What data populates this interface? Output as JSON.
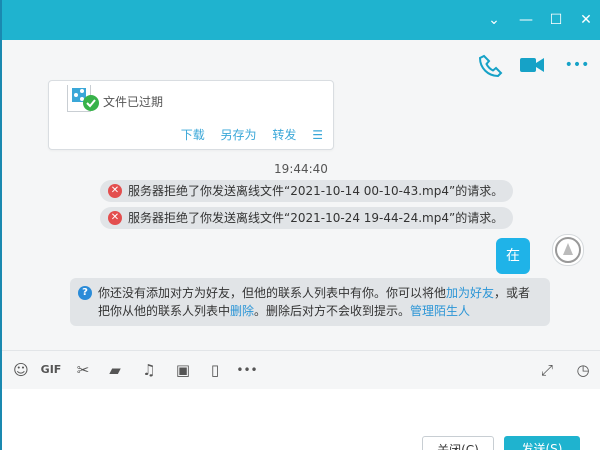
{
  "window": {
    "controls": {
      "dropdown": "⌄",
      "minimize": "—",
      "maximize": "☐",
      "close": "✕"
    }
  },
  "actions": [
    {
      "name": "phone-icon"
    },
    {
      "name": "video-icon"
    },
    {
      "name": "more-icon",
      "label": "•••"
    }
  ],
  "file_card": {
    "status": "文件已过期",
    "links": [
      "下载",
      "另存为",
      "转发",
      "☰"
    ]
  },
  "chat": {
    "time": "19:44:40",
    "notices": [
      "服务器拒绝了你发送离线文件“2021-10-14 00-10-43.mp4”的请求。",
      "服务器拒绝了你发送离线文件“2021-10-24 19-44-24.mp4”的请求。"
    ],
    "my_message": "在",
    "info": {
      "before": "你还没有添加对方为好友，但他的联系人列表中有你。你可以将他",
      "link_add": "加为好友",
      "middle": "，或者把你从他的联系人列表中",
      "link_delete": "删除",
      "after": "。删除后对方不会收到提示。",
      "link_manage": "管理陌生人"
    }
  },
  "toolbar": {
    "emoji": "☺",
    "gif": "GIF",
    "scissors": "✂",
    "folder": "▰",
    "music": "♫",
    "image": "▣",
    "shake": "▯",
    "more": "•••",
    "expand": "⤢",
    "history": "◷"
  },
  "buttons": {
    "close": "关闭(C)",
    "send": "发送(S)"
  }
}
